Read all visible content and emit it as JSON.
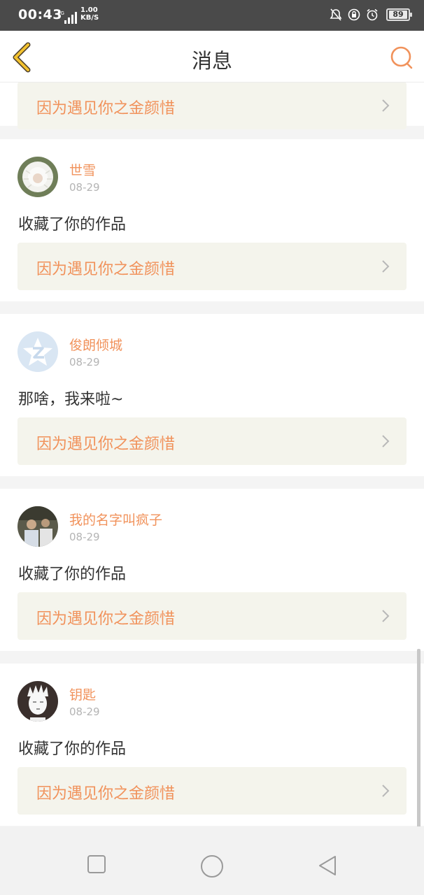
{
  "status_bar": {
    "time": "00:43",
    "net_speed_value": "1.00",
    "net_speed_unit": "KB/S",
    "network_type": "4G",
    "battery": "89"
  },
  "header": {
    "title": "消息",
    "accent_color": "#f1925b"
  },
  "messages": [
    {
      "work_title": "因为遇见你之金颜惜"
    },
    {
      "user_name": "世雪",
      "date": "08-29",
      "text": "收藏了你的作品",
      "work_title": "因为遇见你之金颜惜",
      "avatar_icon": "avatar-dandelion-girl"
    },
    {
      "user_name": "俊朗倾城",
      "date": "08-29",
      "text": "那啥，我来啦~",
      "work_title": "因为遇见你之金颜惜",
      "avatar_icon": "avatar-default-qzone"
    },
    {
      "user_name": "我的名字叫疯子",
      "date": "08-29",
      "text": "收藏了你的作品",
      "work_title": "因为遇见你之金颜惜",
      "avatar_icon": "avatar-people-photo"
    },
    {
      "user_name": "钥匙",
      "date": "08-29",
      "text": "收藏了你的作品",
      "work_title": "因为遇见你之金颜惜",
      "avatar_icon": "avatar-anime-sketch"
    }
  ],
  "nav": {
    "recent_icon": "square-icon",
    "home_icon": "circle-icon",
    "back_icon": "triangle-icon"
  }
}
